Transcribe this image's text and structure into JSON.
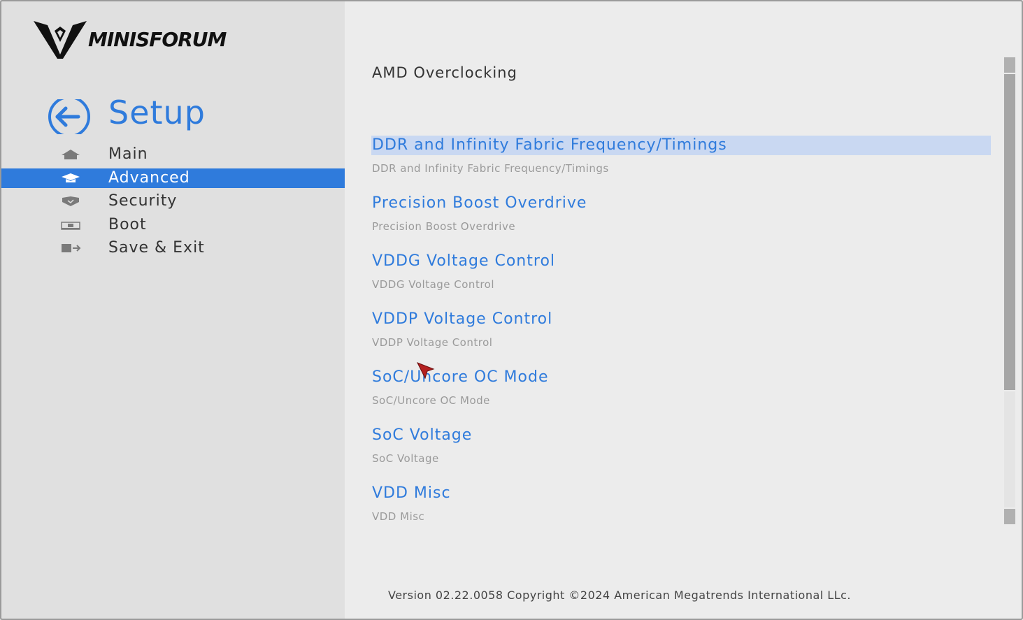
{
  "brand": {
    "logo_text": "MINISFORUM"
  },
  "sidebar": {
    "title": "Setup",
    "back_icon": "back-arrow-circle-icon",
    "items": [
      {
        "label": "Main",
        "icon": "house-icon",
        "active": false
      },
      {
        "label": "Advanced",
        "icon": "graduation-cap-icon",
        "active": true
      },
      {
        "label": "Security",
        "icon": "shield-icon",
        "active": false
      },
      {
        "label": "Boot",
        "icon": "boot-drive-icon",
        "active": false
      },
      {
        "label": "Save & Exit",
        "icon": "exit-door-icon",
        "active": false
      }
    ]
  },
  "main": {
    "title": "AMD Overclocking",
    "entries": [
      {
        "title": "DDR and Infinity Fabric Frequency/Timings",
        "description": "DDR and Infinity Fabric Frequency/Timings",
        "selected": true
      },
      {
        "title": "Precision Boost Overdrive",
        "description": "Precision Boost Overdrive",
        "selected": false
      },
      {
        "title": "VDDG Voltage Control",
        "description": "VDDG Voltage Control",
        "selected": false
      },
      {
        "title": "VDDP Voltage Control",
        "description": "VDDP Voltage Control",
        "selected": false
      },
      {
        "title": "SoC/Uncore OC Mode",
        "description": "SoC/Uncore OC Mode",
        "selected": false
      },
      {
        "title": "SoC Voltage",
        "description": "SoC Voltage",
        "selected": false
      },
      {
        "title": "VDD Misc",
        "description": "VDD Misc",
        "selected": false
      }
    ]
  },
  "footer": {
    "text": "Version 02.22.0058 Copyright ©2024 American Megatrends International LLc."
  },
  "colors": {
    "accent": "#2f7bdc",
    "selection": "#c9d8f2",
    "sidebar_bg": "#e0e0e0",
    "main_bg": "#ececec"
  }
}
